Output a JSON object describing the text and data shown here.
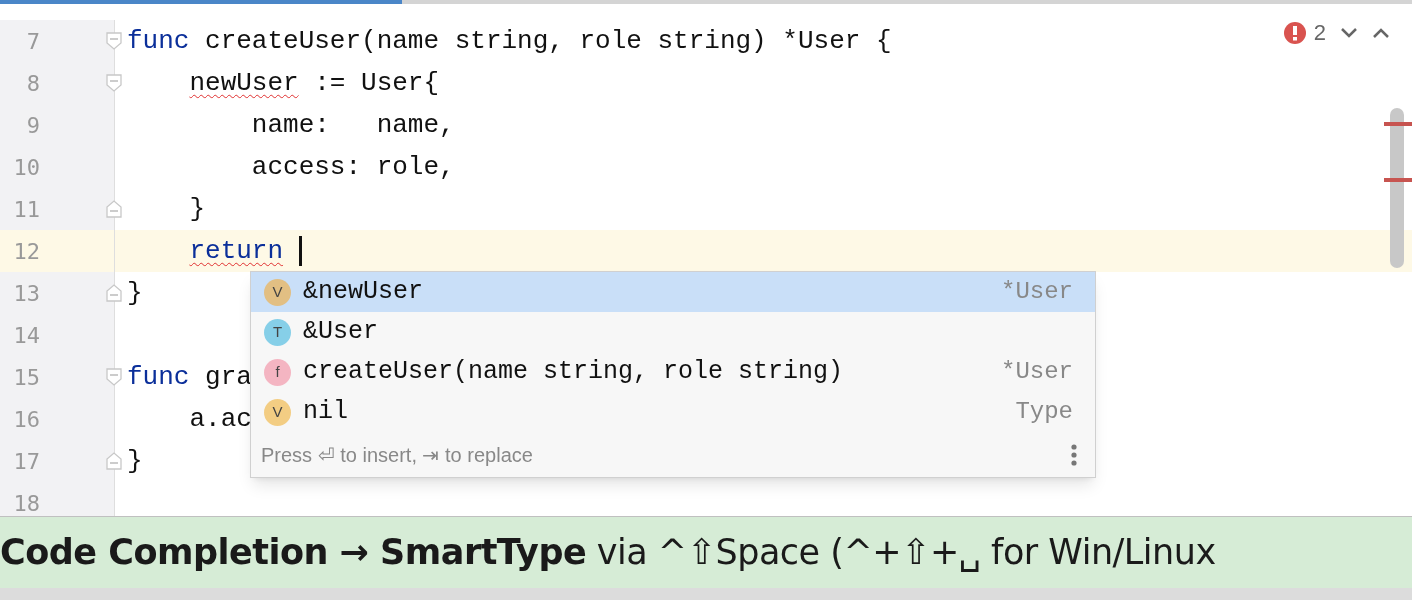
{
  "editor": {
    "lines": [
      {
        "number": "7",
        "fold_start": true,
        "fold_end": false,
        "current": false,
        "tokens": [
          {
            "text": "func",
            "kind": "keyword"
          },
          {
            "text": " createUser(name string, role string) *User {",
            "kind": "plain"
          }
        ]
      },
      {
        "number": "8",
        "fold_start": true,
        "fold_end": false,
        "current": false,
        "tokens": [
          {
            "text": "    newUser",
            "kind": "error"
          },
          {
            "text": " := User{",
            "kind": "plain"
          }
        ]
      },
      {
        "number": "9",
        "fold_start": false,
        "fold_end": false,
        "current": false,
        "tokens": [
          {
            "text": "        name:   name,",
            "kind": "plain"
          }
        ]
      },
      {
        "number": "10",
        "fold_start": false,
        "fold_end": false,
        "current": false,
        "tokens": [
          {
            "text": "        access: role,",
            "kind": "plain"
          }
        ]
      },
      {
        "number": "11",
        "fold_start": false,
        "fold_end": true,
        "current": false,
        "tokens": [
          {
            "text": "    }",
            "kind": "plain"
          }
        ]
      },
      {
        "number": "12",
        "fold_start": false,
        "fold_end": false,
        "current": true,
        "tokens": [
          {
            "text": "    return",
            "kind": "keyword-error"
          }
        ]
      },
      {
        "number": "13",
        "fold_start": false,
        "fold_end": true,
        "current": false,
        "tokens": [
          {
            "text": "}",
            "kind": "plain"
          }
        ]
      },
      {
        "number": "14",
        "fold_start": false,
        "fold_end": false,
        "current": false
      },
      {
        "number": "15",
        "fold_start": true,
        "fold_end": false,
        "current": false,
        "tokens": [
          {
            "text": "func",
            "kind": "keyword"
          },
          {
            "text": " gra",
            "kind": "plain"
          }
        ]
      },
      {
        "number": "16",
        "fold_start": false,
        "fold_end": false,
        "current": false,
        "tokens": [
          {
            "text": "    a.ac",
            "kind": "plain"
          }
        ]
      },
      {
        "number": "17",
        "fold_start": false,
        "fold_end": true,
        "current": false,
        "tokens": [
          {
            "text": "}",
            "kind": "plain"
          }
        ]
      },
      {
        "number": "18",
        "fold_start": false,
        "fold_end": false,
        "current": false
      }
    ],
    "problems": {
      "count": "2"
    }
  },
  "completion": {
    "items": [
      {
        "icon": "V",
        "color": "#e2bf83",
        "label": "&newUser",
        "type": "*User",
        "selected": true
      },
      {
        "icon": "T",
        "color": "#86cfe8",
        "label": "&User",
        "selected": false
      },
      {
        "icon": "f",
        "color": "#f4b5c2",
        "label": "createUser(name string, role string)",
        "type": "*User",
        "selected": false
      },
      {
        "icon": "V",
        "color": "#f3cd83",
        "label": "nil",
        "type": "Type",
        "selected": false
      }
    ],
    "hint": "Press ⏎ to insert, ⇥ to replace"
  },
  "banner": {
    "text": "**Code Completion → SmartType** via ^⇧Space (^+⇧+␣ for Win/Linux"
  }
}
